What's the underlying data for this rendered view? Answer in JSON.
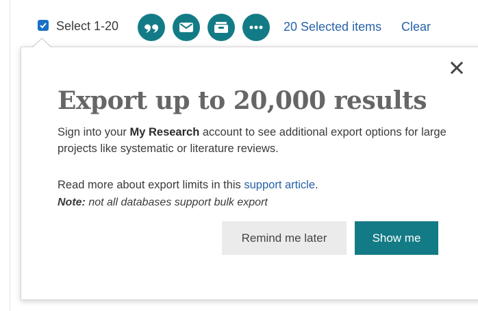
{
  "toolbar": {
    "select_label": "Select 1-20",
    "select_checked": true,
    "action_buttons": [
      {
        "icon": "quote-icon",
        "name": "cite-button"
      },
      {
        "icon": "envelope-icon",
        "name": "email-button"
      },
      {
        "icon": "save-box-icon",
        "name": "save-button"
      },
      {
        "icon": "more-dots-icon",
        "name": "more-actions-button"
      }
    ],
    "selected_text": "20 Selected items",
    "clear_text": "Clear"
  },
  "popover": {
    "title": "Export up to 20,000 results",
    "body_before": "Sign into your ",
    "body_bold": "My Research",
    "body_after": " account to see additional export options for large projects like systematic or literature reviews.",
    "read_more_before": "Read more about export limits in this ",
    "read_more_link": "support article",
    "read_more_after": ".",
    "note_label": "Note:",
    "note_text": " not all databases support bulk export",
    "remind_label": "Remind me later",
    "show_label": "Show me",
    "close_icon": "close-icon"
  },
  "colors": {
    "accent": "#137b86",
    "link": "#2762a9",
    "checkbox": "#1a6fc7",
    "title": "#666666"
  }
}
